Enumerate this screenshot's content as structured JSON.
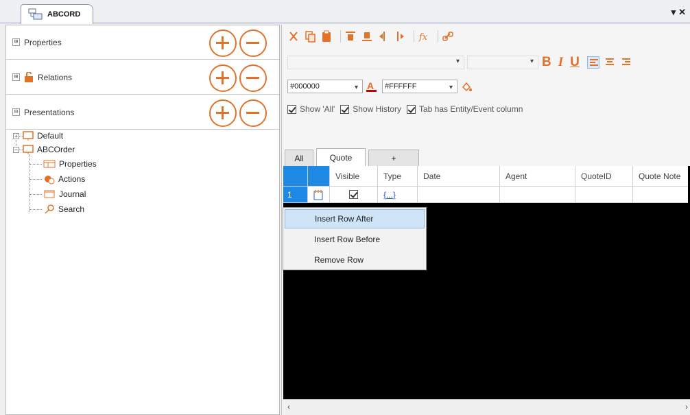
{
  "document_tab": {
    "label": "ABCORD",
    "controls": {
      "dropdown": "▾",
      "close": "✕"
    }
  },
  "left_panel": {
    "sections": [
      {
        "label": "Properties",
        "expander": "⊞"
      },
      {
        "label": "Relations",
        "expander": "⊞"
      },
      {
        "label": "Presentations",
        "expander": "⊟"
      }
    ],
    "tree": {
      "nodes": [
        "Default",
        "ABCOrder",
        "Properties",
        "Actions",
        "Journal",
        "Search"
      ]
    }
  },
  "toolbar": {
    "font_name": "",
    "font_size": "",
    "format_buttons": [
      "B",
      "I",
      "U"
    ],
    "fore_color": "#000000",
    "back_color": "#FFFFFF",
    "checkboxes": [
      {
        "label": "Show 'All'",
        "checked": true
      },
      {
        "label": "Show History",
        "checked": true
      },
      {
        "label": "Tab has Entity/Event column",
        "checked": true
      }
    ]
  },
  "tabs": [
    "All",
    "Quote",
    "+"
  ],
  "active_tab": "Quote",
  "grid": {
    "columns": [
      "",
      "",
      "Visible",
      "Type",
      "Date",
      "Agent",
      "QuoteID",
      "Quote Note"
    ],
    "rows": [
      {
        "number": "1",
        "visible": true,
        "type": "{...}"
      }
    ]
  },
  "context_menu": {
    "items": [
      "Insert Row After",
      "Insert Row Before",
      "Remove Row"
    ],
    "highlighted_index": 0
  },
  "colors": {
    "accent": "#e2722a",
    "selection": "#1e88e5",
    "menu_highlight": "#cfe4f7"
  }
}
